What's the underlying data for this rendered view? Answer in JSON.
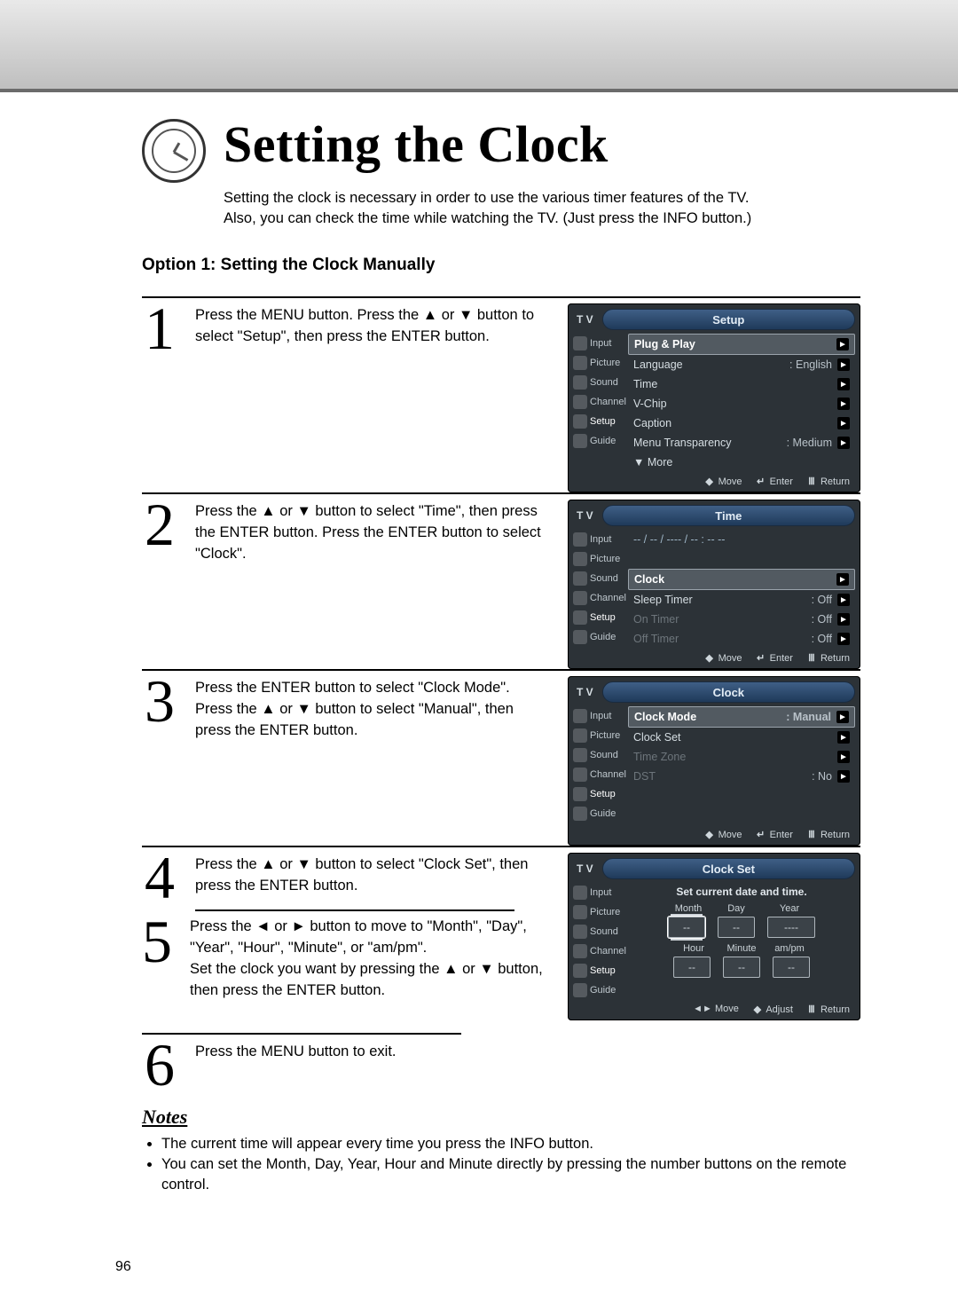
{
  "page_number": "96",
  "title": "Setting the Clock",
  "intro_line1": "Setting the clock is necessary in order to use the various timer features of the TV.",
  "intro_line2": "Also, you can check the time while watching the TV. (Just press the INFO button.)",
  "option_heading": "Option 1: Setting the Clock Manually",
  "glyph": {
    "up": "▲",
    "down": "▼",
    "left": "◄",
    "right": "►",
    "updown": "◆",
    "lr": "◄►",
    "enter": "↵",
    "menu": "Ⅲ"
  },
  "steps": {
    "s1": {
      "num": "1",
      "text": "Press the MENU button. Press the ▲ or ▼ button to select \"Setup\", then press the ENTER button."
    },
    "s2": {
      "num": "2",
      "text": "Press the ▲ or ▼ button to select \"Time\", then press the ENTER button. Press the ENTER button to select \"Clock\"."
    },
    "s3": {
      "num": "3",
      "text": "Press the ENTER button to select \"Clock Mode\". Press the ▲ or ▼ button to select \"Manual\", then press the ENTER button."
    },
    "s4": {
      "num": "4",
      "text": "Press the ▲ or ▼ button to select \"Clock Set\", then press the ENTER button."
    },
    "s5": {
      "num": "5",
      "text": "Press the ◄ or ► button to move to \"Month\", \"Day\", \"Year\", \"Hour\", \"Minute\", or \"am/pm\".\nSet the clock you want by pressing the ▲ or ▼ button, then press the ENTER button."
    },
    "s6": {
      "num": "6",
      "text": "Press the MENU button to exit."
    }
  },
  "osd": {
    "tv_label": "T V",
    "side": [
      "Input",
      "Picture",
      "Sound",
      "Channel",
      "Setup",
      "Guide"
    ],
    "foot_move": "Move",
    "foot_enter": "Enter",
    "foot_return": "Return",
    "foot_adjust": "Adjust",
    "setup": {
      "title": "Setup",
      "rows": [
        {
          "label": "Plug & Play",
          "value": "",
          "hl": true,
          "chev": true
        },
        {
          "label": "Language",
          "value": ": English",
          "chev": true
        },
        {
          "label": "Time",
          "value": "",
          "chev": true
        },
        {
          "label": "V-Chip",
          "value": "",
          "chev": true
        },
        {
          "label": "Caption",
          "value": "",
          "chev": true
        },
        {
          "label": "Menu Transparency",
          "value": ": Medium",
          "chev": true
        },
        {
          "label": "▼ More",
          "value": ""
        }
      ]
    },
    "time": {
      "title": "Time",
      "top_text": "-- / -- / ---- / -- : -- --",
      "rows": [
        {
          "label": "Clock",
          "value": "",
          "hl": true,
          "chev": true
        },
        {
          "label": "Sleep Timer",
          "value": ": Off",
          "chev": true
        },
        {
          "label": "On Timer",
          "value": ": Off",
          "dim": true,
          "chev": true
        },
        {
          "label": "Off Timer",
          "value": ": Off",
          "dim": true,
          "chev": true
        }
      ]
    },
    "clock": {
      "title": "Clock",
      "rows": [
        {
          "label": "Clock Mode",
          "value": ": Manual",
          "hl": true,
          "chev": true
        },
        {
          "label": "Clock Set",
          "value": "",
          "chev": true
        },
        {
          "label": "Time Zone",
          "value": "",
          "dim": true,
          "chev": true
        },
        {
          "label": "DST",
          "value": ": No",
          "dim": true,
          "chev": true
        }
      ]
    },
    "clockset": {
      "title": "Clock Set",
      "msg": "Set current date and time.",
      "labels1": [
        "Month",
        "Day",
        "Year"
      ],
      "fields1": [
        "--",
        "--",
        "----"
      ],
      "labels2": [
        "Hour",
        "Minute",
        "am/pm"
      ],
      "fields2": [
        "--",
        "--",
        "--"
      ]
    }
  },
  "notes": {
    "heading": "Notes",
    "items": [
      "The current time will appear every time you press the INFO button.",
      "You can set the Month, Day, Year, Hour and Minute directly by pressing the number buttons on the remote control."
    ]
  }
}
